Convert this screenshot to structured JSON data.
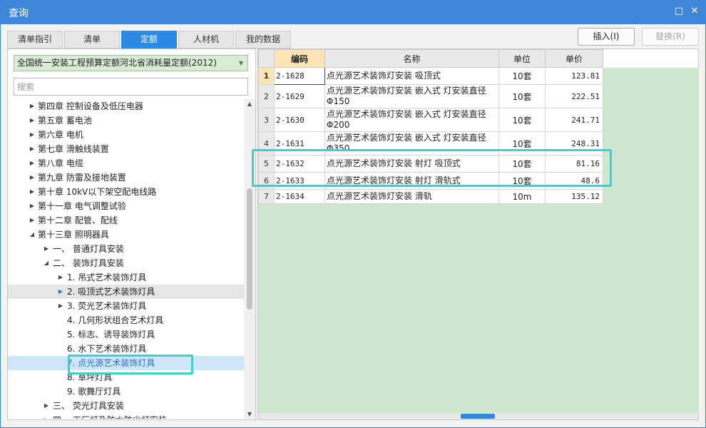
{
  "window": {
    "title": "查询",
    "maximize_icon": "□",
    "close_icon": "✕"
  },
  "tabs": [
    {
      "label": "清单指引",
      "active": false
    },
    {
      "label": "清单",
      "active": false
    },
    {
      "label": "定额",
      "active": true
    },
    {
      "label": "人材机",
      "active": false
    },
    {
      "label": "我的数据",
      "active": false
    }
  ],
  "toolbar": {
    "insert_label": "插入(I)",
    "replace_label": "替换(R)"
  },
  "library": {
    "selected": "全国统一安装工程预算定额河北省消耗量定额(2012)"
  },
  "search": {
    "placeholder": "搜索"
  },
  "tree": [
    {
      "label": "第四章 控制设备及低压电器",
      "level": 1,
      "state": "collapsed"
    },
    {
      "label": "第五章 蓄电池",
      "level": 1,
      "state": "collapsed"
    },
    {
      "label": "第六章 电机",
      "level": 1,
      "state": "collapsed"
    },
    {
      "label": "第七章 滑触线装置",
      "level": 1,
      "state": "collapsed"
    },
    {
      "label": "第八章 电缆",
      "level": 1,
      "state": "collapsed"
    },
    {
      "label": "第九章 防雷及接地装置",
      "level": 1,
      "state": "collapsed"
    },
    {
      "label": "第十章 10kV以下架空配电线路",
      "level": 1,
      "state": "collapsed"
    },
    {
      "label": "第十一章 电气调整试验",
      "level": 1,
      "state": "collapsed"
    },
    {
      "label": "第十二章 配管、配线",
      "level": 1,
      "state": "collapsed"
    },
    {
      "label": "第十三章 照明器具",
      "level": 1,
      "state": "expanded"
    },
    {
      "label": "一、 普通灯具安装",
      "level": 2,
      "state": "collapsed"
    },
    {
      "label": "二、 装饰灯具安装",
      "level": 2,
      "state": "expanded"
    },
    {
      "label": "1. 吊式艺术装饰灯具",
      "level": 3,
      "state": "collapsed"
    },
    {
      "label": "2. 吸顶式艺术装饰灯具",
      "level": 3,
      "state": "collapsed",
      "hover": true
    },
    {
      "label": "3. 荧光艺术装饰灯具",
      "level": 3,
      "state": "collapsed"
    },
    {
      "label": "4. 几何形状组合艺术灯具",
      "level": 3,
      "state": "leaf"
    },
    {
      "label": "5. 标志、诱导装饰灯具",
      "level": 3,
      "state": "leaf"
    },
    {
      "label": "6. 水下艺术装饰灯具",
      "level": 3,
      "state": "leaf"
    },
    {
      "label": "7. 点光源艺术装饰灯具",
      "level": 3,
      "state": "leaf",
      "selected": true
    },
    {
      "label": "8. 草坪灯具",
      "level": 3,
      "state": "leaf"
    },
    {
      "label": "9. 歌舞厅灯具",
      "level": 3,
      "state": "leaf"
    },
    {
      "label": "三、 荧光灯具安装",
      "level": 2,
      "state": "collapsed"
    },
    {
      "label": "四、 工厂灯及防水防尘灯安装",
      "level": 2,
      "state": "collapsed"
    }
  ],
  "table": {
    "headers": {
      "code": "编码",
      "name": "名称",
      "unit": "单位",
      "price": "单价"
    },
    "rows": [
      {
        "no": "1",
        "code": "2-1628",
        "name": "点光源艺术装饰灯安装 吸顶式",
        "unit": "10套",
        "price": "123.81"
      },
      {
        "no": "2",
        "code": "2-1629",
        "name": "点光源艺术装饰灯安装 嵌入式 灯安装直径Φ150",
        "unit": "10套",
        "price": "222.51"
      },
      {
        "no": "3",
        "code": "2-1630",
        "name": "点光源艺术装饰灯安装 嵌入式 灯安装直径Φ200",
        "unit": "10套",
        "price": "241.71"
      },
      {
        "no": "4",
        "code": "2-1631",
        "name": "点光源艺术装饰灯安装 嵌入式 灯安装直径Φ350",
        "unit": "10套",
        "price": "248.31"
      },
      {
        "no": "5",
        "code": "2-1632",
        "name": "点光源艺术装饰灯安装 射灯 吸顶式",
        "unit": "10套",
        "price": "81.16"
      },
      {
        "no": "6",
        "code": "2-1633",
        "name": "点光源艺术装饰灯安装 射灯 滑轨式",
        "unit": "10套",
        "price": "48.6"
      },
      {
        "no": "7",
        "code": "2-1634",
        "name": "点光源艺术装饰灯安装 滑轨",
        "unit": "10m",
        "price": "135.12"
      }
    ]
  },
  "icons": {
    "tree_collapsed": "chevron-right-icon",
    "tree_expanded": "chevron-down-icon",
    "dropdown": "dropdown-arrow-icon"
  }
}
